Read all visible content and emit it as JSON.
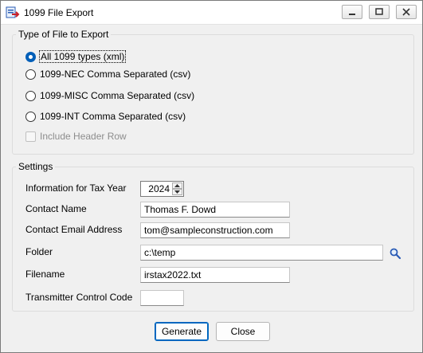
{
  "window": {
    "title": "1099 File Export",
    "icon": "export-app-icon",
    "controls": [
      "minimize-icon",
      "maximize-icon",
      "close-icon"
    ]
  },
  "file_type_group": {
    "legend": "Type of File to Export",
    "options": [
      {
        "label": "All 1099 types (xml)",
        "checked": true
      },
      {
        "label": "1099-NEC Comma Separated (csv)",
        "checked": false
      },
      {
        "label": "1099-MISC Comma Separated (csv)",
        "checked": false
      },
      {
        "label": "1099-INT Comma Separated (csv)",
        "checked": false
      }
    ],
    "include_header": {
      "label": "Include Header Row",
      "checked": false,
      "disabled": true
    }
  },
  "settings_group": {
    "legend": "Settings",
    "tax_year": {
      "label": "Information for Tax Year",
      "value": "2024"
    },
    "contact_name": {
      "label": "Contact Name",
      "value": "Thomas F. Dowd"
    },
    "contact_email": {
      "label": "Contact Email Address",
      "value": "tom@sampleconstruction.com"
    },
    "folder": {
      "label": "Folder",
      "value": "c:\\temp",
      "icon": "search-icon"
    },
    "filename": {
      "label": "Filename",
      "value": "irstax2022.txt"
    },
    "transmitter_code": {
      "label": "Transmitter Control Code",
      "value": ""
    }
  },
  "buttons": {
    "generate": "Generate",
    "close": "Close"
  },
  "colors": {
    "accent": "#005fb8",
    "window_bg": "#f0f0f0",
    "disabled_text": "#8d8d8d"
  }
}
